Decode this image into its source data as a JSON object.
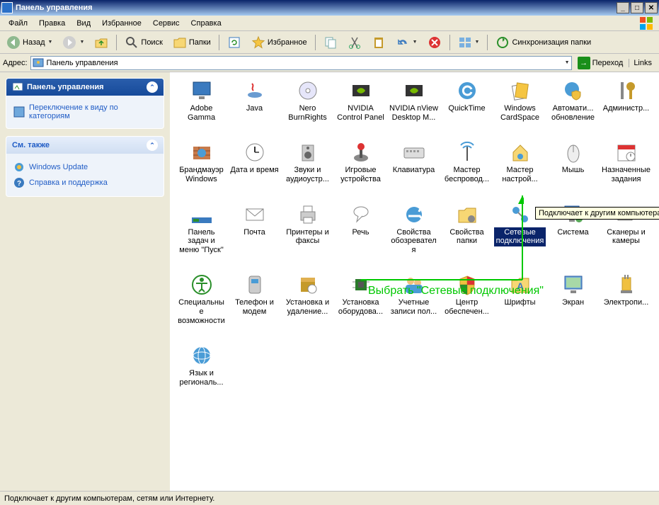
{
  "window": {
    "title": "Панель управления",
    "buttons": {
      "min": "_",
      "max": "□",
      "close": "✕"
    }
  },
  "menu": [
    "Файл",
    "Правка",
    "Вид",
    "Избранное",
    "Сервис",
    "Справка"
  ],
  "toolbar": {
    "back": "Назад",
    "search": "Поиск",
    "folders": "Папки",
    "favorites": "Избранное",
    "sync": "Синхронизация папки"
  },
  "address": {
    "label": "Адрес:",
    "value": "Панель управления",
    "go": "Переход",
    "links": "Links"
  },
  "sidepane": {
    "panel1": {
      "title": "Панель управления",
      "link1": "Переключение к виду по категориям"
    },
    "panel2": {
      "title": "См. также",
      "link1": "Windows Update",
      "link2": "Справка и поддержка"
    }
  },
  "tooltip": "Подключает к другим компьютерам,",
  "status": "Подключает к другим компьютерам, сетям или Интернету.",
  "annotation": "Выбрать \"Сетевые подключения\"",
  "items": [
    {
      "name": "adobe-gamma",
      "label": "Adobe Gamma",
      "icon": "monitor"
    },
    {
      "name": "java",
      "label": "Java",
      "icon": "java"
    },
    {
      "name": "nero",
      "label": "Nero BurnRights",
      "icon": "disc"
    },
    {
      "name": "nvidia-cp",
      "label": "NVIDIA Control Panel",
      "icon": "nvidia"
    },
    {
      "name": "nvidia-nview",
      "label": "NVIDIA nView Desktop M...",
      "icon": "nvidia"
    },
    {
      "name": "quicktime",
      "label": "QuickTime",
      "icon": "qt"
    },
    {
      "name": "cardspace",
      "label": "Windows CardSpace",
      "icon": "cards"
    },
    {
      "name": "auto-update",
      "label": "Автомати... обновление",
      "icon": "globe-shield"
    },
    {
      "name": "admin",
      "label": "Администр...",
      "icon": "tools"
    },
    {
      "name": "firewall",
      "label": "Брандмауэр Windows",
      "icon": "wall"
    },
    {
      "name": "datetime",
      "label": "Дата и время",
      "icon": "clock"
    },
    {
      "name": "sounds",
      "label": "Звуки и аудиоустр...",
      "icon": "speaker"
    },
    {
      "name": "games",
      "label": "Игровые устройства",
      "icon": "joystick"
    },
    {
      "name": "keyboard",
      "label": "Клавиатура",
      "icon": "keyboard"
    },
    {
      "name": "wireless",
      "label": "Мастер беспровод...",
      "icon": "antenna"
    },
    {
      "name": "network-wiz",
      "label": "Мастер настрой...",
      "icon": "house-net"
    },
    {
      "name": "mouse",
      "label": "Мышь",
      "icon": "mouse"
    },
    {
      "name": "scheduled",
      "label": "Назначенные задания",
      "icon": "calendar"
    },
    {
      "name": "taskbar",
      "label": "Панель задач и меню \"Пуск\"",
      "icon": "taskbar"
    },
    {
      "name": "mail",
      "label": "Почта",
      "icon": "mail"
    },
    {
      "name": "printers",
      "label": "Принтеры и факсы",
      "icon": "printer"
    },
    {
      "name": "speech",
      "label": "Речь",
      "icon": "speech"
    },
    {
      "name": "inet-options",
      "label": "Свойства обозревателя",
      "icon": "ie"
    },
    {
      "name": "folder-opts",
      "label": "Свойства папки",
      "icon": "folder-gear"
    },
    {
      "name": "network-conn",
      "label": "Сетевые подключения",
      "icon": "net-conn",
      "selected": true
    },
    {
      "name": "system",
      "label": "Система",
      "icon": "system"
    },
    {
      "name": "scanners",
      "label": "Сканеры и камеры",
      "icon": "camera"
    },
    {
      "name": "accessibility",
      "label": "Специальные возможности",
      "icon": "access"
    },
    {
      "name": "phone",
      "label": "Телефон и модем",
      "icon": "phone"
    },
    {
      "name": "add-remove",
      "label": "Установка и удаление...",
      "icon": "box"
    },
    {
      "name": "hardware",
      "label": "Установка оборудова...",
      "icon": "chip"
    },
    {
      "name": "users",
      "label": "Учетные записи пол...",
      "icon": "users"
    },
    {
      "name": "security",
      "label": "Центр обеспечен...",
      "icon": "shield"
    },
    {
      "name": "fonts",
      "label": "Шрифты",
      "icon": "fonts"
    },
    {
      "name": "display",
      "label": "Экран",
      "icon": "display"
    },
    {
      "name": "power",
      "label": "Электропи...",
      "icon": "power"
    },
    {
      "name": "regional",
      "label": "Язык и региональ...",
      "icon": "globe"
    }
  ]
}
